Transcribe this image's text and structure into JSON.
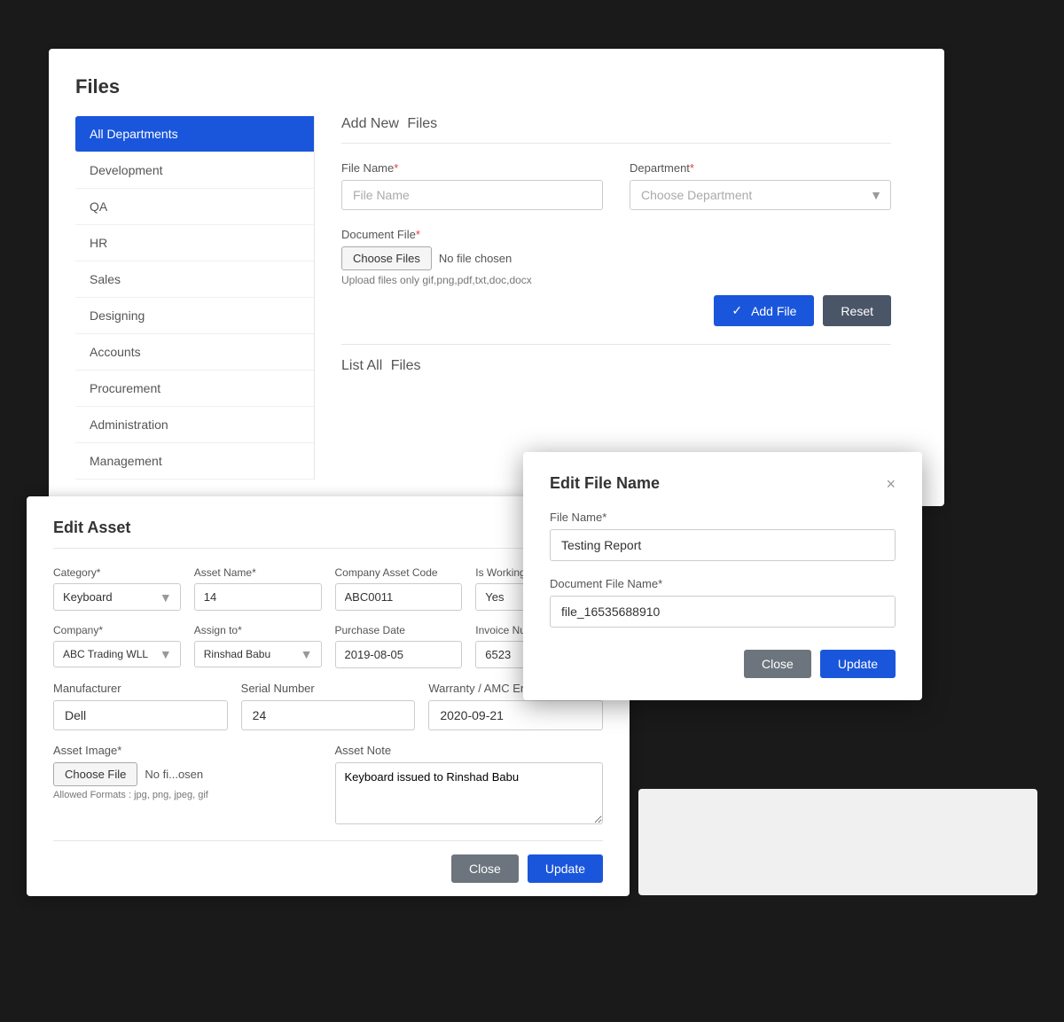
{
  "filesPanel": {
    "title": "Files",
    "addNewLabel": "Add New",
    "addNewSuffix": "Files",
    "listAllLabel": "List All",
    "listAllSuffix": "Files",
    "sidebar": {
      "items": [
        {
          "label": "All Departments",
          "active": true
        },
        {
          "label": "Development",
          "active": false
        },
        {
          "label": "QA",
          "active": false
        },
        {
          "label": "HR",
          "active": false
        },
        {
          "label": "Sales",
          "active": false
        },
        {
          "label": "Designing",
          "active": false
        },
        {
          "label": "Accounts",
          "active": false
        },
        {
          "label": "Procurement",
          "active": false
        },
        {
          "label": "Administration",
          "active": false
        },
        {
          "label": "Management",
          "active": false
        }
      ]
    },
    "form": {
      "fileNameLabel": "File Name",
      "fileNameRequired": "*",
      "fileNamePlaceholder": "File Name",
      "departmentLabel": "Department",
      "departmentRequired": "*",
      "departmentPlaceholder": "Choose Department",
      "documentFileLabel": "Document File",
      "documentFileRequired": "*",
      "chooseFilesBtn": "Choose Files",
      "noFileText": "No file chosen",
      "uploadHint": "Upload files only gif,png,pdf,txt,doc,docx",
      "addFileBtn": "Add File",
      "resetBtn": "Reset"
    }
  },
  "editAssetPanel": {
    "title": "Edit Asset",
    "fields": {
      "categoryLabel": "Category*",
      "categoryValue": "Keyboard",
      "assetNameLabel": "Asset Name*",
      "assetNameValue": "14",
      "companyAssetCodeLabel": "Company Asset Code",
      "companyAssetCodeValue": "ABC0011",
      "isWorkingLabel": "Is Working?",
      "isWorkingValue": "Yes",
      "companyLabel": "Company*",
      "companyValue": "ABC Trading WLL",
      "assignToLabel": "Assign to*",
      "assignToValue": "Rinshad Babu",
      "purchaseDateLabel": "Purchase Date",
      "purchaseDateValue": "2019-08-05",
      "invoiceNumLabel": "Invoice Num",
      "invoiceNumValue": "6523",
      "manufacturerLabel": "Manufacturer",
      "manufacturerValue": "Dell",
      "serialNumberLabel": "Serial Number",
      "serialNumberValue": "24",
      "warrantyLabel": "Warranty / AMC End Date",
      "warrantyValue": "2020-09-21",
      "assetImageLabel": "Asset Image*",
      "chooseFileBtn": "Choose File",
      "noFileText": "No fi...osen",
      "allowedFormats": "Allowed Formats : jpg, png, jpeg, gif",
      "assetNoteLabel": "Asset Note",
      "assetNoteValue": "Keyboard issued to Rinshad Babu",
      "closeBtn": "Close",
      "updateBtn": "Update"
    }
  },
  "editFileModal": {
    "title": "Edit File Name",
    "closeSymbol": "×",
    "fileNameLabel": "File Name*",
    "fileNameValue": "Testing Report",
    "documentFileNameLabel": "Document File Name*",
    "documentFileNameValue": "file_16535688910",
    "closeBtn": "Close",
    "updateBtn": "Update"
  }
}
